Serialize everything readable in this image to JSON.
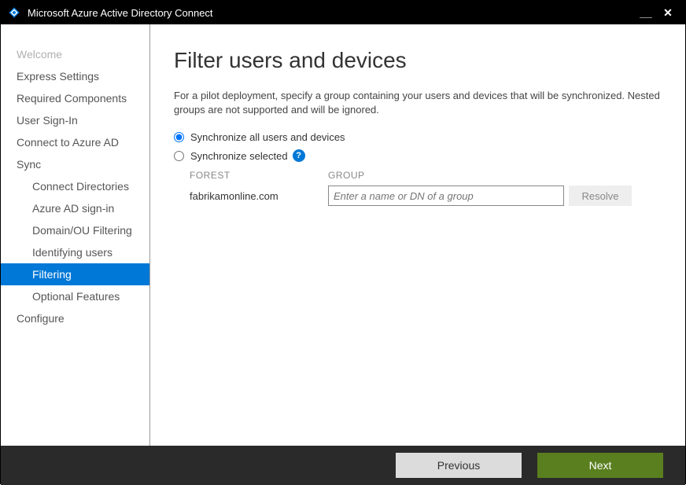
{
  "titlebar": {
    "title": "Microsoft Azure Active Directory Connect"
  },
  "sidebar": {
    "items": [
      {
        "label": "Welcome",
        "sub": false,
        "disabled": true,
        "selected": false
      },
      {
        "label": "Express Settings",
        "sub": false,
        "disabled": false,
        "selected": false
      },
      {
        "label": "Required Components",
        "sub": false,
        "disabled": false,
        "selected": false
      },
      {
        "label": "User Sign-In",
        "sub": false,
        "disabled": false,
        "selected": false
      },
      {
        "label": "Connect to Azure AD",
        "sub": false,
        "disabled": false,
        "selected": false
      },
      {
        "label": "Sync",
        "sub": false,
        "disabled": false,
        "selected": false
      },
      {
        "label": "Connect Directories",
        "sub": true,
        "disabled": false,
        "selected": false
      },
      {
        "label": "Azure AD sign-in",
        "sub": true,
        "disabled": false,
        "selected": false
      },
      {
        "label": "Domain/OU Filtering",
        "sub": true,
        "disabled": false,
        "selected": false
      },
      {
        "label": "Identifying users",
        "sub": true,
        "disabled": false,
        "selected": false
      },
      {
        "label": "Filtering",
        "sub": true,
        "disabled": false,
        "selected": true
      },
      {
        "label": "Optional Features",
        "sub": true,
        "disabled": false,
        "selected": false
      },
      {
        "label": "Configure",
        "sub": false,
        "disabled": false,
        "selected": false
      }
    ]
  },
  "content": {
    "heading": "Filter users and devices",
    "description": "For a pilot deployment, specify a group containing your users and devices that will be synchronized. Nested groups are not supported and will be ignored.",
    "radio1": "Synchronize all users and devices",
    "radio2": "Synchronize selected",
    "forest_header": "FOREST",
    "group_header": "GROUP",
    "forest_value": "fabrikamonline.com",
    "group_placeholder": "Enter a name or DN of a group",
    "resolve_label": "Resolve"
  },
  "footer": {
    "previous": "Previous",
    "next": "Next"
  }
}
